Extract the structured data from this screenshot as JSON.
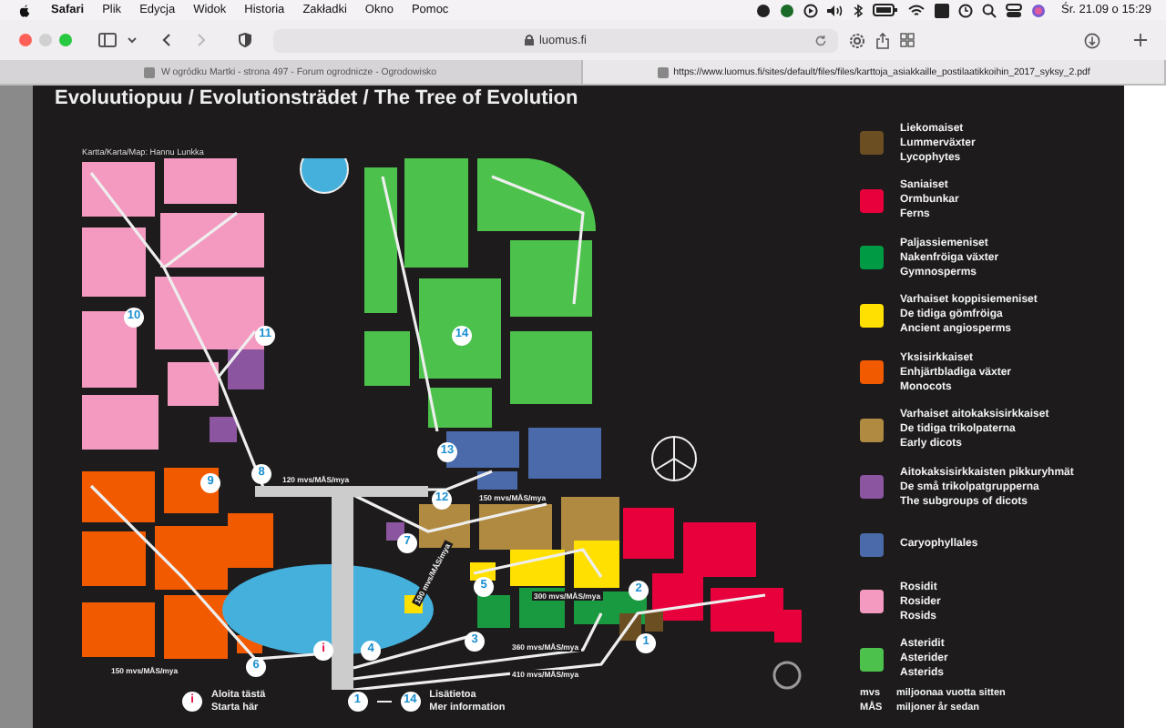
{
  "menu_bar": {
    "app": "Safari",
    "items": [
      "Plik",
      "Edycja",
      "Widok",
      "Historia",
      "Zakładki",
      "Okno",
      "Pomoc"
    ],
    "clock": "Śr. 21.09 o 15:29"
  },
  "toolbar": {
    "address": "luomus.fi"
  },
  "tabs": [
    {
      "label": "W ogródku Martki - strona 497 - Forum ogrodnicze - Ogrodowisko",
      "selected": false
    },
    {
      "label": "https://www.luomus.fi/sites/default/files/files/karttoja_asiakkaille_postilaatikkoihin_2017_syksy_2.pdf",
      "selected": true
    }
  ],
  "map": {
    "title": "Evoluutiopuu / Evolutionsträdet / The Tree of Evolution",
    "credit": "Kartta/Karta/Map: Hannu Lunkka",
    "markers": [
      {
        "text": "10",
        "kind": "number"
      },
      {
        "text": "11",
        "kind": "number"
      },
      {
        "text": "14",
        "kind": "number"
      },
      {
        "text": "13",
        "kind": "number"
      },
      {
        "text": "8",
        "kind": "number"
      },
      {
        "text": "9",
        "kind": "number"
      },
      {
        "text": "12",
        "kind": "number"
      },
      {
        "text": "7",
        "kind": "number"
      },
      {
        "text": "5",
        "kind": "number"
      },
      {
        "text": "2",
        "kind": "number"
      },
      {
        "text": "3",
        "kind": "number"
      },
      {
        "text": "1",
        "kind": "number"
      },
      {
        "text": "i",
        "kind": "info"
      },
      {
        "text": "4",
        "kind": "number"
      },
      {
        "text": "6",
        "kind": "number"
      }
    ],
    "distance_labels": [
      "120 mvs/MÅS/mya",
      "150 mvs/MÅS/mya",
      "300 mvs/MÅS/mya",
      "190 mvs/MÅS/mya",
      "360 mvs/MÅS/mya",
      "410 mvs/MÅS/mya",
      "150 mvs/MÅS/mya"
    ],
    "key": {
      "start": {
        "marker": "i",
        "lines": [
          "Aloita tästä",
          "Starta här"
        ]
      },
      "info": {
        "from": "1",
        "to": "14",
        "lines": [
          "Lisätietoa",
          "Mer information"
        ]
      }
    }
  },
  "legend": {
    "items": [
      {
        "color": "#6b4f22",
        "lines": [
          "Liekomaiset",
          "Lummerväxter",
          "Lycophytes"
        ]
      },
      {
        "color": "#e8003c",
        "lines": [
          "Saniaiset",
          "Ormbunkar",
          "Ferns"
        ]
      },
      {
        "color": "#009a44",
        "lines": [
          "Paljassiemeniset",
          "Nakenfröiga växter",
          "Gymnosperms"
        ]
      },
      {
        "color": "#ffe000",
        "lines": [
          "Varhaiset koppisiemeniset",
          "De tidiga gömfröiga",
          "Ancient angiosperms"
        ]
      },
      {
        "color": "#f25a00",
        "lines": [
          "Yksisirkkaiset",
          "Enhjärtbladiga växter",
          "Monocots"
        ]
      },
      {
        "color": "#b08a40",
        "lines": [
          "Varhaiset aitokaksisirkkaiset",
          "De tidiga trikolpaterna",
          "Early dicots"
        ]
      },
      {
        "color": "#8b55a0",
        "lines": [
          "Aitokaksisirkkaisten pikkuryhmät",
          "De små trikolpatgrupperna",
          "The subgroups of dicots"
        ]
      },
      {
        "color": "#4a6aaa",
        "lines": [
          "Caryophyllales"
        ]
      },
      {
        "color": "#f49ac1",
        "lines": [
          "Rosidit",
          "Rosider",
          "Rosids"
        ]
      },
      {
        "color": "#4cc24c",
        "lines": [
          "Asteridit",
          "Asterider",
          "Asterids"
        ]
      }
    ],
    "abbreviations": [
      {
        "abbr": "mvs",
        "meaning": "miljoonaa vuotta sitten"
      },
      {
        "abbr": "MÅS",
        "meaning": "miljoner år sedan"
      }
    ]
  }
}
